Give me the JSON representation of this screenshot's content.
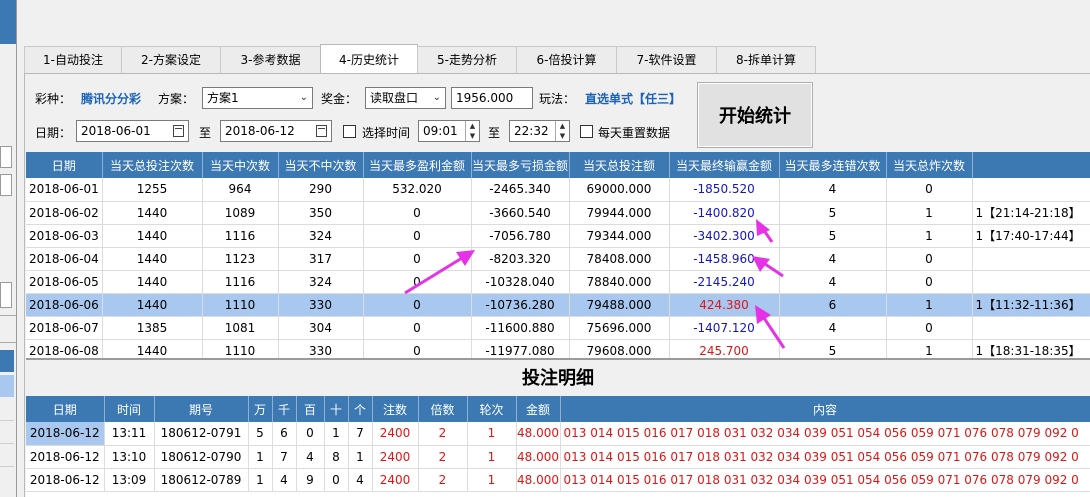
{
  "tabs": [
    "1-自动投注",
    "2-方案设定",
    "3-参考数据",
    "4-历史统计",
    "5-走势分析",
    "6-倍投计算",
    "7-软件设置",
    "8-拆单计算"
  ],
  "active_tab": 3,
  "form": {
    "lottery_label": "彩种：",
    "lottery_value": "腾讯分分彩",
    "plan_label": "方案：",
    "plan_value": "方案1",
    "bonus_label": "奖金：",
    "bonus_select": "读取盘口",
    "bonus_value": "1956.000",
    "play_label": "玩法：",
    "play_value": "直选单式【任三】",
    "date_label": "日期：",
    "date_from": "2018-06-01",
    "to1": "至",
    "date_to": "2018-06-12",
    "select_time_label": "选择时间",
    "time_from": "09:01",
    "to2": "至",
    "time_to": "22:32",
    "daily_reset_label": "每天重置数据",
    "start_button": "开始统计"
  },
  "stats": {
    "columns": [
      "日期",
      "当天总投注次数",
      "当天中次数",
      "当天不中次数",
      "当天最多盈利金额",
      "当天最多亏损金额",
      "当天总投注额",
      "当天最终输赢金额",
      "当天最多连错次数",
      "当天总炸次数",
      ""
    ],
    "rows": [
      [
        "2018-06-01",
        "1255",
        "964",
        "290",
        "532.020",
        "-2465.340",
        "69000.000",
        "-1850.520",
        "4",
        "0",
        ""
      ],
      [
        "2018-06-02",
        "1440",
        "1089",
        "350",
        "0",
        "-3660.540",
        "79944.000",
        "-1400.820",
        "5",
        "1",
        "1【21:14-21:18】"
      ],
      [
        "2018-06-03",
        "1440",
        "1116",
        "324",
        "0",
        "-7056.780",
        "79344.000",
        "-3402.300",
        "5",
        "1",
        "1【17:40-17:44】"
      ],
      [
        "2018-06-04",
        "1440",
        "1123",
        "317",
        "0",
        "-8203.320",
        "78408.000",
        "-1458.960",
        "4",
        "0",
        ""
      ],
      [
        "2018-06-05",
        "1440",
        "1116",
        "324",
        "0",
        "-10328.040",
        "78840.000",
        "-2145.240",
        "4",
        "0",
        ""
      ],
      [
        "2018-06-06",
        "1440",
        "1110",
        "330",
        "0",
        "-10736.280",
        "79488.000",
        "424.380",
        "6",
        "1",
        "1【11:32-11:36】"
      ],
      [
        "2018-06-07",
        "1385",
        "1081",
        "304",
        "0",
        "-11600.880",
        "75696.000",
        "-1407.120",
        "4",
        "0",
        ""
      ],
      [
        "2018-06-08",
        "1440",
        "1110",
        "330",
        "0",
        "-11977.080",
        "79608.000",
        "245.700",
        "5",
        "1",
        "1【18:31-18:35】"
      ]
    ],
    "highlight_row": 5
  },
  "detail_title": "投注明细",
  "detail": {
    "columns": [
      "日期",
      "时间",
      "期号",
      "万",
      "千",
      "百",
      "十",
      "个",
      "注数",
      "倍数",
      "轮次",
      "金额",
      "内容"
    ],
    "rows": [
      [
        "2018-06-12",
        "13:11",
        "180612-0791",
        "5",
        "6",
        "0",
        "1",
        "7",
        "2400",
        "2",
        "1",
        "48.000",
        "013 014 015 016 017 018 031 032 034 039 051 054 056 059 071 076 078 079 092 0"
      ],
      [
        "2018-06-12",
        "13:10",
        "180612-0790",
        "1",
        "7",
        "4",
        "8",
        "1",
        "2400",
        "2",
        "1",
        "48.000",
        "013 014 015 016 017 018 031 032 034 039 051 054 056 059 071 076 078 079 092 0"
      ],
      [
        "2018-06-12",
        "13:09",
        "180612-0789",
        "1",
        "4",
        "9",
        "0",
        "4",
        "2400",
        "2",
        "1",
        "48.000",
        "013 014 015 016 017 018 031 032 034 039 051 054 056 059 071 076 078 079 092 0"
      ]
    ]
  },
  "colors": {
    "header_blue": "#3c79b3",
    "highlight": "#a8c8ef",
    "arrow": "#e632e6",
    "neg_blue": "#1414c8",
    "pos_red": "#e01515"
  }
}
